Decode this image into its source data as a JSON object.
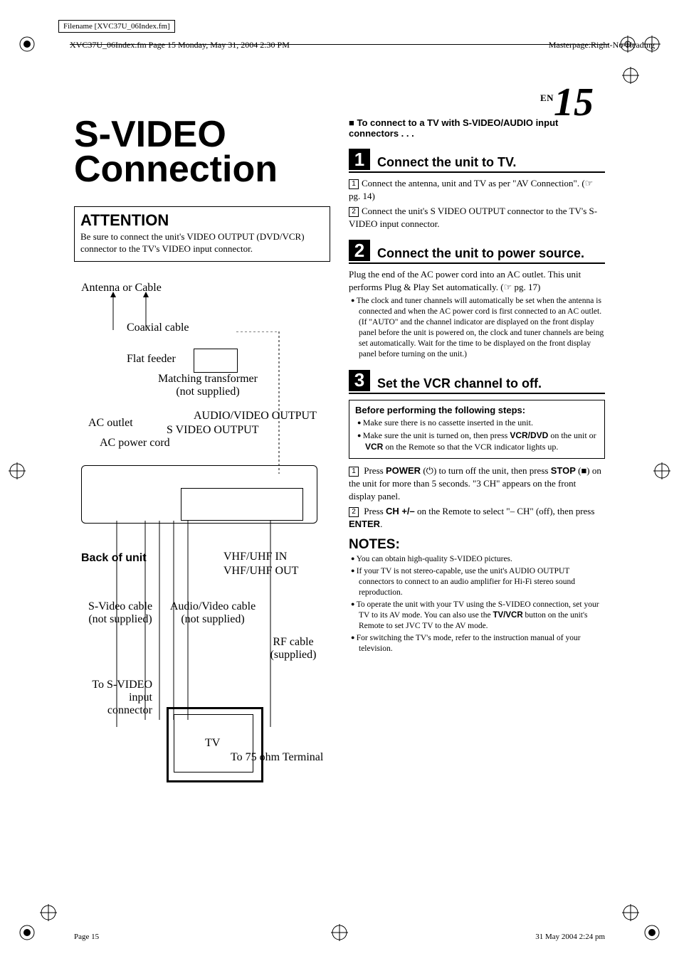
{
  "header": {
    "filename": "Filename [XVC37U_06Index.fm]",
    "frameline": "XVC37U_06Index.fm  Page 15  Monday, May 31, 2004  2:30 PM",
    "masterpage": "Masterpage:Right-No-Heading"
  },
  "pagenum": {
    "prefix": "EN",
    "num": "15"
  },
  "title": "S-VIDEO Connection",
  "attention": {
    "heading": "ATTENTION",
    "text": "Be sure to connect the unit's VIDEO OUTPUT (DVD/VCR) connector to the TV's VIDEO input connector."
  },
  "diagram": {
    "antenna": "Antenna or Cable",
    "coax": "Coaxial cable",
    "flat": "Flat feeder",
    "mt1": "Matching transformer",
    "mt2": "(not supplied)",
    "acoutlet": "AC outlet",
    "accord": "AC power cord",
    "avout": "AUDIO/VIDEO OUTPUT",
    "svout": "S VIDEO OUTPUT",
    "backofunit": "Back of unit",
    "vhfin": "VHF/UHF IN",
    "vhfout": "VHF/UHF OUT",
    "svidcable1": "S-Video cable",
    "svidcable2": "(not supplied)",
    "avcable1": "Audio/Video cable",
    "avcable2": "(not supplied)",
    "rf1": "RF cable",
    "rf2": "(supplied)",
    "tosvid1": "To S-VIDEO input",
    "tosvid2": "connector",
    "tv": "TV",
    "to75": "To 75 ohm Terminal"
  },
  "instr": {
    "leadin": "To connect to a TV with S-VIDEO/AUDIO input connectors . . .",
    "s1": {
      "num": "1",
      "title": "Connect the unit to TV.",
      "li1": "Connect the antenna, unit and TV as per \"AV Connection\". (☞ pg. 14)",
      "li2": "Connect the unit's S VIDEO OUTPUT connector to the TV's S-VIDEO input connector."
    },
    "s2": {
      "num": "2",
      "title": "Connect the unit to power source.",
      "p": "Plug the end of the AC power cord into an AC outlet. This unit performs Plug & Play Set automatically. (☞ pg. 17)",
      "b1": "The clock and tuner channels will automatically be set when the antenna is connected and when the AC power cord is first connected to an AC outlet. (If \"AUTO\" and the channel indicator are displayed on the front display panel before the unit is powered on, the clock and tuner channels are being set automatically. Wait for the time to be displayed on the front display panel before turning on the unit.)"
    },
    "s3": {
      "num": "3",
      "title": "Set the VCR channel to off.",
      "before_h": "Before performing the following steps:",
      "before_b1": "Make sure there is no cassette inserted in the unit.",
      "before_b2a": "Make sure the unit is turned on, then press ",
      "before_b2b": "VCR/DVD",
      "before_b2c": " on the unit or ",
      "before_b2d": "VCR",
      "before_b2e": " on the Remote so that the VCR indicator lights up.",
      "li1a": "Press ",
      "li1b": "POWER",
      "li1c": " (⏻) to turn off the unit, then press ",
      "li1d": "STOP",
      "li1e": " (■) on the unit for more than 5 seconds. \"3 CH\" appears on the front display panel.",
      "li2a": "Press ",
      "li2b": "CH +/–",
      "li2c": " on the Remote to select \"– CH\" (off), then press ",
      "li2d": "ENTER",
      "li2e": "."
    }
  },
  "notes": {
    "heading": "NOTES:",
    "n1": "You can obtain high-quality S-VIDEO pictures.",
    "n2": "If your TV is not stereo-capable, use the unit's AUDIO OUTPUT connectors to connect to an audio amplifier for Hi-Fi stereo sound reproduction.",
    "n3a": "To operate the unit with your TV using the S-VIDEO connection, set your TV to its AV mode. You can also use the ",
    "n3b": "TV/VCR",
    "n3c": " button on the unit's Remote to set JVC TV to the AV mode.",
    "n4": "For switching the TV's mode, refer to the instruction manual of your television."
  },
  "footer": {
    "left": "Page 15",
    "right": "31 May 2004 2:24 pm"
  }
}
